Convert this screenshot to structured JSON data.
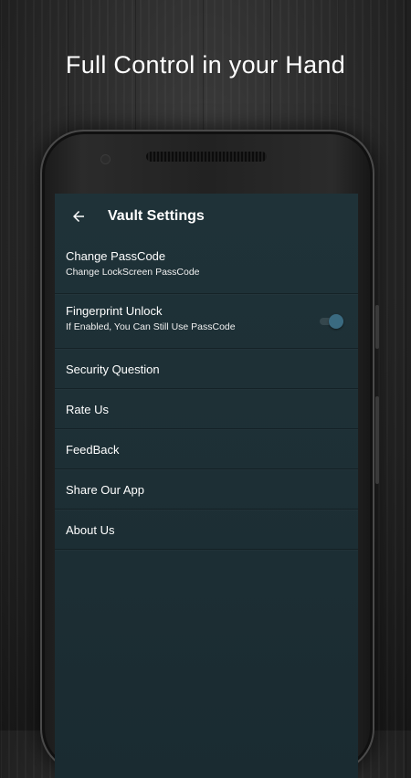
{
  "promo": {
    "headline": "Full Control in your Hand"
  },
  "toolbar": {
    "back_icon": "arrow-left-icon",
    "title": "Vault Settings"
  },
  "settings": [
    {
      "title": "Change PassCode",
      "subtitle": "Change LockScreen PassCode"
    },
    {
      "title": "Fingerprint Unlock",
      "subtitle": "If Enabled, You Can Still Use PassCode",
      "toggle_on": true
    },
    {
      "title": "Security Question"
    },
    {
      "title": "Rate Us"
    },
    {
      "title": "FeedBack"
    },
    {
      "title": "Share Our App"
    },
    {
      "title": "About Us"
    }
  ],
  "colors": {
    "screen_bg": "#1f3238",
    "toggle_thumb": "#3a6a80",
    "text": "#ffffff"
  }
}
